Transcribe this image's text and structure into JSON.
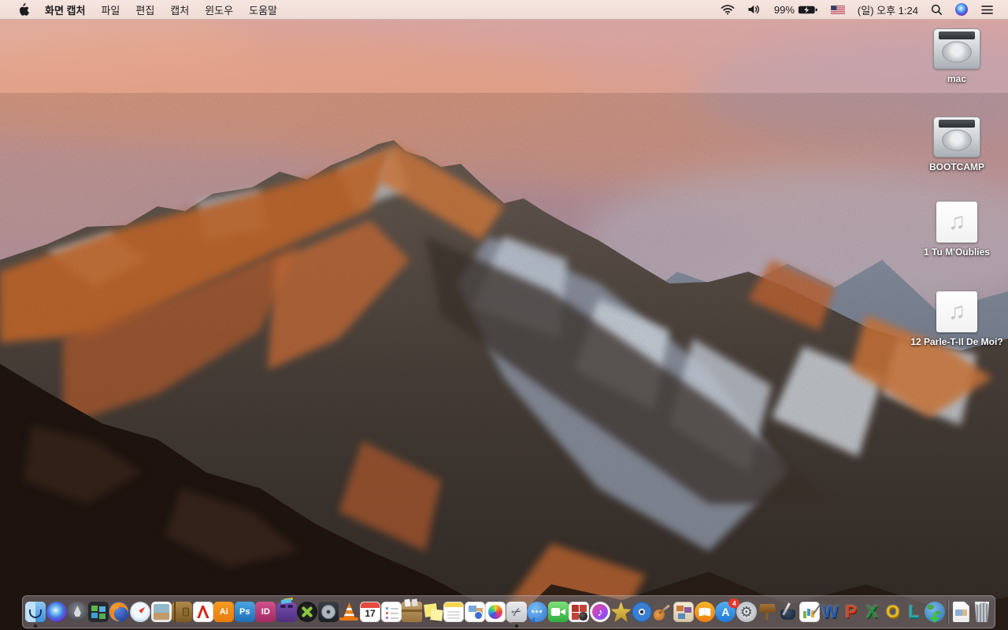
{
  "menu_bar": {
    "app_name": "화면 캡처",
    "menus": [
      "파일",
      "편집",
      "캡처",
      "윈도우",
      "도움말"
    ],
    "status": {
      "battery_percent": "99%",
      "clock": "(일) 오후 1:24",
      "icons": [
        "wifi",
        "volume",
        "battery-charging",
        "input-source-us-flag",
        "spotlight",
        "siri",
        "notification-center"
      ]
    },
    "colors": {
      "bar_background": "#f4e2dd",
      "text": "#1c1c1e"
    }
  },
  "desktop": {
    "icons": [
      {
        "id": "mac",
        "type": "hard-drive",
        "label": "mac"
      },
      {
        "id": "bootcamp",
        "type": "hard-drive",
        "label": "BOOTCAMP"
      },
      {
        "id": "tu-moublies",
        "type": "audio-file",
        "label": "1 Tu M'Oublies"
      },
      {
        "id": "parle-t-il-de-moi",
        "type": "audio-file",
        "label": "12 Parle-T-Il De Moi?"
      }
    ]
  },
  "dock": {
    "colors": {
      "background": "rgba(150,143,148,0.48)",
      "badge": "#e5392d"
    },
    "apps": [
      {
        "id": "finder",
        "running": true
      },
      {
        "id": "siri"
      },
      {
        "id": "launchpad"
      },
      {
        "id": "mission-control"
      },
      {
        "id": "firefox"
      },
      {
        "id": "safari"
      },
      {
        "id": "preview"
      },
      {
        "id": "contacts"
      },
      {
        "id": "acrobat-reader"
      },
      {
        "id": "illustrator",
        "glyph": "Ai"
      },
      {
        "id": "photoshop",
        "glyph": "Ps"
      },
      {
        "id": "indesign",
        "glyph": "ID"
      },
      {
        "id": "toast"
      },
      {
        "id": "xbmc"
      },
      {
        "id": "disk-utility-app"
      },
      {
        "id": "vlc"
      },
      {
        "id": "calendar",
        "glyph": "17"
      },
      {
        "id": "reminders"
      },
      {
        "id": "archive-box"
      },
      {
        "id": "stickies"
      },
      {
        "id": "notes"
      },
      {
        "id": "collage-doc"
      },
      {
        "id": "photos"
      },
      {
        "id": "grab",
        "running": true
      },
      {
        "id": "messages"
      },
      {
        "id": "facetime"
      },
      {
        "id": "photo-grid"
      },
      {
        "id": "itunes"
      },
      {
        "id": "star-app"
      },
      {
        "id": "disc-app"
      },
      {
        "id": "garageband"
      },
      {
        "id": "comic-life"
      },
      {
        "id": "ibooks"
      },
      {
        "id": "app-store",
        "glyph": "A",
        "badge": "4"
      },
      {
        "id": "system-preferences"
      },
      {
        "id": "keynote"
      },
      {
        "id": "pages"
      },
      {
        "id": "numbers"
      },
      {
        "id": "word",
        "glyph": "W"
      },
      {
        "id": "powerpoint",
        "glyph": "P"
      },
      {
        "id": "excel",
        "glyph": "X"
      },
      {
        "id": "outlook",
        "glyph": "O"
      },
      {
        "id": "lync",
        "glyph": "L"
      },
      {
        "id": "downloader"
      }
    ],
    "files": [
      {
        "id": "document"
      }
    ],
    "trash": {
      "id": "trash"
    }
  }
}
